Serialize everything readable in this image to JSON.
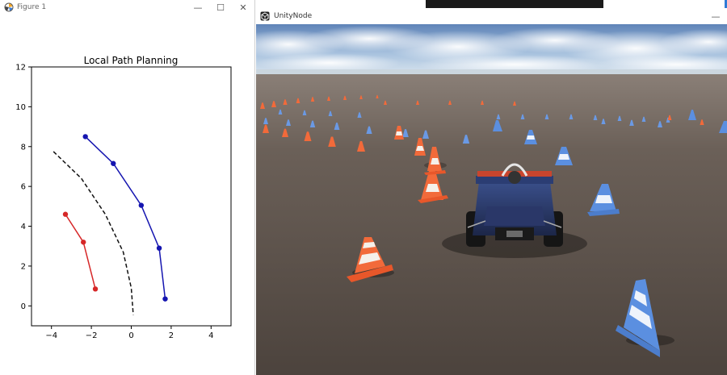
{
  "figure_window": {
    "title": "Figure 1",
    "icon": "matplotlib-icon",
    "buttons": {
      "minimize": "—",
      "maximize": "☐",
      "close": "✕"
    }
  },
  "unity_window": {
    "title": "UnityNode",
    "icon": "unity-icon",
    "minimize": "—"
  },
  "colors": {
    "red_path": "#d62728",
    "blue_path": "#1515b0",
    "center_path": "#111111",
    "orange_cone": "#f26a3a",
    "blue_cone": "#5b8fe0",
    "ground": "#5a5048",
    "sky": "#a9c3df"
  },
  "chart_data": {
    "type": "line",
    "title": "Local Path Planning",
    "xlabel": "",
    "ylabel": "",
    "xlim": [
      -5,
      5
    ],
    "ylim": [
      -1,
      12
    ],
    "xticks": [
      "−4",
      "−2",
      "0",
      "2",
      "4"
    ],
    "yticks": [
      "0",
      "2",
      "4",
      "6",
      "8",
      "10",
      "12"
    ],
    "grid": false,
    "series": [
      {
        "color": "#d62728",
        "style": "solid-markers",
        "points": [
          [
            -3.3,
            4.6
          ],
          [
            -2.4,
            3.2
          ],
          [
            -1.8,
            0.85
          ]
        ]
      },
      {
        "color": "#1515b0",
        "style": "solid-markers",
        "points": [
          [
            -2.3,
            8.5
          ],
          [
            -0.9,
            7.15
          ],
          [
            0.5,
            5.05
          ],
          [
            1.4,
            2.9
          ],
          [
            1.7,
            0.35
          ]
        ]
      },
      {
        "color": "#111111",
        "style": "dashed",
        "points": [
          [
            -3.9,
            7.75
          ],
          [
            -2.5,
            6.4
          ],
          [
            -1.3,
            4.6
          ],
          [
            -0.4,
            2.7
          ],
          [
            0.0,
            0.9
          ],
          [
            0.1,
            -0.45
          ]
        ]
      }
    ]
  }
}
